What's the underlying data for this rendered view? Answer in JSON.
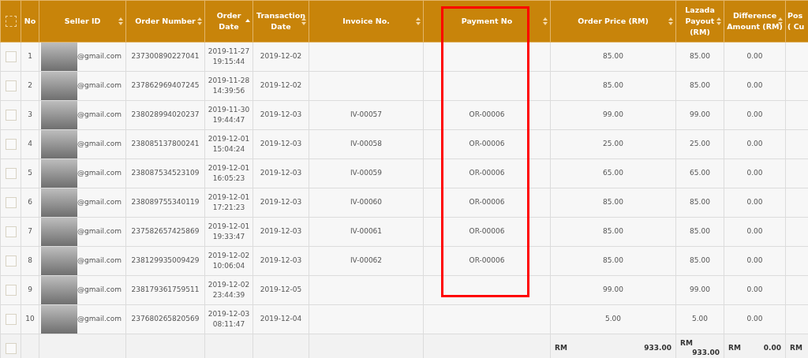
{
  "table": {
    "header_checkbox": {
      "checked": false
    },
    "columns": [
      {
        "label": "No",
        "sortable": false
      },
      {
        "label": "Seller ID",
        "sortable": true
      },
      {
        "label": "Order Number",
        "sortable": true
      },
      {
        "label": "Order Date",
        "sortable": true,
        "sorted_ascending": true
      },
      {
        "label": "Transaction Date",
        "sortable": true
      },
      {
        "label": "Invoice No.",
        "sortable": true
      },
      {
        "label": "Payment No",
        "sortable": true,
        "highlighted": true
      },
      {
        "label": "Order Price (RM)",
        "sortable": true
      },
      {
        "label": "Lazada Payout (RM)",
        "sortable": true
      },
      {
        "label": "Difference Amount (RM)",
        "sortable": true
      },
      {
        "label": "Pos ( Cu",
        "sortable": false
      }
    ],
    "rows": [
      {
        "checked": false,
        "no": "1",
        "seller": "@gmail.com",
        "order_number": "237300890227041",
        "order_date": "2019-11-27 19:15:44",
        "transaction_date": "2019-12-02",
        "order_price": "85.00",
        "payout": "85.00",
        "difference": "0.00"
      },
      {
        "checked": false,
        "no": "2",
        "seller": "@gmail.com",
        "order_number": "237862969407245",
        "order_date": "2019-11-28 14:39:56",
        "transaction_date": "2019-12-02",
        "order_price": "85.00",
        "payout": "85.00",
        "difference": "0.00"
      },
      {
        "checked": false,
        "no": "3",
        "seller": "@gmail.com",
        "order_number": "238028994020237",
        "order_date": "2019-11-30 19:44:47",
        "transaction_date": "2019-12-03",
        "invoice": "IV-00057",
        "payment": "OR-00006",
        "order_price": "99.00",
        "payout": "99.00",
        "difference": "0.00"
      },
      {
        "checked": false,
        "no": "4",
        "seller": "@gmail.com",
        "order_number": "238085137800241",
        "order_date": "2019-12-01 15:04:24",
        "transaction_date": "2019-12-03",
        "invoice": "IV-00058",
        "payment": "OR-00006",
        "order_price": "25.00",
        "payout": "25.00",
        "difference": "0.00"
      },
      {
        "checked": false,
        "no": "5",
        "seller": "@gmail.com",
        "order_number": "238087534523109",
        "order_date": "2019-12-01 16:05:23",
        "transaction_date": "2019-12-03",
        "invoice": "IV-00059",
        "payment": "OR-00006",
        "order_price": "65.00",
        "payout": "65.00",
        "difference": "0.00"
      },
      {
        "checked": false,
        "no": "6",
        "seller": "@gmail.com",
        "order_number": "238089755340119",
        "order_date": "2019-12-01 17:21:23",
        "transaction_date": "2019-12-03",
        "invoice": "IV-00060",
        "payment": "OR-00006",
        "order_price": "85.00",
        "payout": "85.00",
        "difference": "0.00"
      },
      {
        "checked": false,
        "no": "7",
        "seller": "@gmail.com",
        "order_number": "237582657425869",
        "order_date": "2019-12-01 19:33:47",
        "transaction_date": "2019-12-03",
        "invoice": "IV-00061",
        "payment": "OR-00006",
        "order_price": "85.00",
        "payout": "85.00",
        "difference": "0.00"
      },
      {
        "checked": false,
        "no": "8",
        "seller": "@gmail.com",
        "order_number": "238129935009429",
        "order_date": "2019-12-02 10:06:04",
        "transaction_date": "2019-12-03",
        "invoice": "IV-00062",
        "payment": "OR-00006",
        "order_price": "85.00",
        "payout": "85.00",
        "difference": "0.00"
      },
      {
        "checked": false,
        "no": "9",
        "seller": "@gmail.com",
        "order_number": "238179361759511",
        "order_date": "2019-12-02 23:44:39",
        "transaction_date": "2019-12-05",
        "order_price": "99.00",
        "payout": "99.00",
        "difference": "0.00"
      },
      {
        "checked": false,
        "no": "10",
        "seller": "@gmail.com",
        "order_number": "237680265820569",
        "order_date": "2019-12-03 08:11:47",
        "transaction_date": "2019-12-04",
        "order_price": "5.00",
        "payout": "5.00",
        "difference": "0.00"
      }
    ],
    "footer": {
      "checked": false,
      "totals": [
        {
          "currency": "RM",
          "amount": "933.00"
        },
        {
          "currency": "RM",
          "amount": "933.00"
        },
        {
          "currency": "RM",
          "amount": "0.00"
        },
        {
          "currency": "RM"
        }
      ]
    }
  }
}
